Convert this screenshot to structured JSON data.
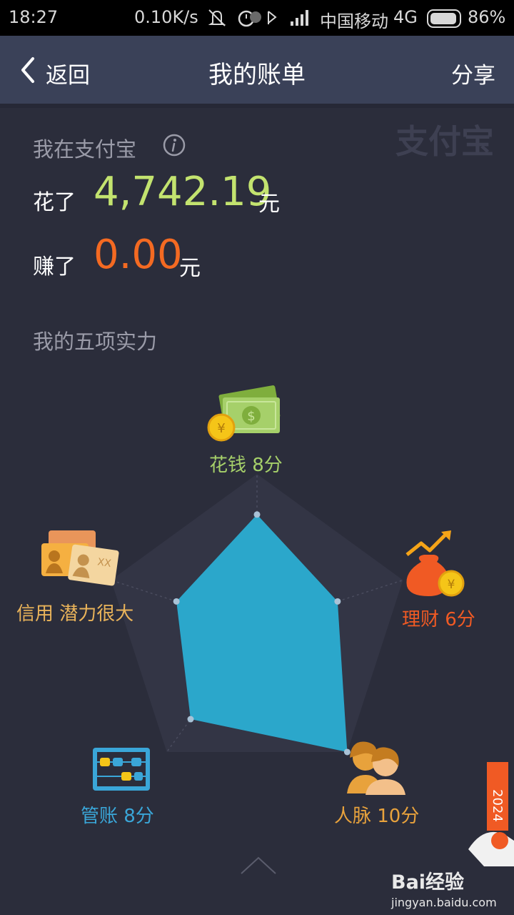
{
  "status_bar": {
    "time": "18:27",
    "speed": "0.10K/s",
    "carrier": "中国移动",
    "network": "4G",
    "battery": "86%"
  },
  "nav": {
    "back_label": "返回",
    "title": "我的账单",
    "share_label": "分享"
  },
  "summary": {
    "label": "我在支付宝",
    "spent_label": "花了",
    "spent_amount": "4,742.19",
    "spent_unit": "元",
    "earned_label": "赚了",
    "earned_amount": "0.00",
    "earned_unit": "元",
    "logo_text": "支付宝"
  },
  "abilities": {
    "title": "我的五项实力",
    "items": [
      {
        "key": "spending",
        "label": "花钱 8分",
        "score": 8,
        "color": "#a6d06a",
        "icon": "money-icon"
      },
      {
        "key": "finance",
        "label": "理财 6分",
        "score": 6,
        "color": "#f05a24",
        "icon": "money-bag-icon"
      },
      {
        "key": "network",
        "label": "人脉 10分",
        "score": 10,
        "color": "#e8a23c",
        "icon": "people-icon"
      },
      {
        "key": "bookkeeping",
        "label": "管账 8分",
        "score": 8,
        "color": "#3aa6d8",
        "icon": "abacus-icon"
      },
      {
        "key": "credit",
        "label": "信用 潜力很大",
        "score": null,
        "color": "#e9b35a",
        "icon": "id-cards-icon"
      }
    ],
    "fill_color": "#2ba7cb"
  },
  "watermark": {
    "brand": "Bai经验",
    "url": "jingyan.baidu.com",
    "tag": "2024"
  }
}
